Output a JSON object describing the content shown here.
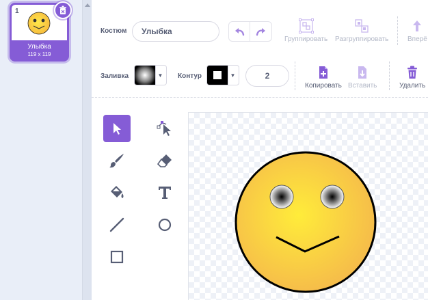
{
  "costume_list": {
    "items": [
      {
        "number": "1",
        "name": "Улыбка",
        "size": "119 x 119"
      }
    ]
  },
  "editor": {
    "costume_label": "Костюм",
    "costume_name": "Улыбка",
    "toolbar_top": {
      "group": "Группировать",
      "ungroup": "Разгруппировать",
      "forward": "Вперё"
    },
    "fill_label": "Заливка",
    "outline_label": "Контур",
    "outline_width": "2",
    "toolbar_bottom": {
      "copy": "Копировать",
      "paste": "Вставить",
      "delete": "Удалить"
    }
  },
  "colors": {
    "accent": "#855cd6",
    "text": "#575e75",
    "disabled": "#b3b8c7"
  },
  "tools": [
    "select",
    "reshape",
    "brush",
    "eraser",
    "fill",
    "text",
    "line",
    "circle",
    "rectangle"
  ]
}
